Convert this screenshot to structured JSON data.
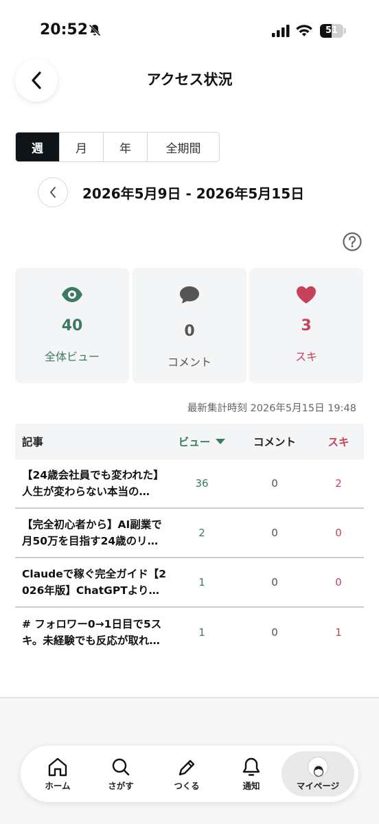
{
  "status_bar": {
    "time": "20:52",
    "battery": "51",
    "battery_level": 0.51
  },
  "header": {
    "title": "アクセス状況"
  },
  "period_tabs": [
    {
      "label": "週",
      "active": true
    },
    {
      "label": "月",
      "active": false
    },
    {
      "label": "年",
      "active": false
    },
    {
      "label": "全期間",
      "active": false
    }
  ],
  "date_range": "2026年5月9日 - 2026年5月15日",
  "stats": {
    "views": {
      "value": "40",
      "label": "全体ビュー",
      "color": "#3d7a66",
      "icon": "eye-icon"
    },
    "comments": {
      "value": "0",
      "label": "コメント",
      "color": "#555555",
      "icon": "speech-bubble-icon"
    },
    "likes": {
      "value": "3",
      "label": "スキ",
      "color": "#c8415a",
      "icon": "heart-icon"
    }
  },
  "updated_at": "最新集計時刻 2026年5月15日 19:48",
  "table": {
    "headers": {
      "title": "記事",
      "views": "ビュー",
      "comments": "コメント",
      "likes": "スキ"
    },
    "rows": [
      {
        "line1": "【24歳会社員でも変われた】",
        "line2": "人生が変わらない本当の…",
        "views": "36",
        "comments": "0",
        "likes": "2"
      },
      {
        "line1": "【完全初心者から】AI副業で",
        "line2": "月50万を目指す24歳のリ…",
        "views": "2",
        "comments": "0",
        "likes": "0"
      },
      {
        "line1": "Claudeで稼ぐ完全ガイド【2",
        "line2": "026年版】ChatGPTより…",
        "views": "1",
        "comments": "0",
        "likes": "0"
      },
      {
        "line1": "# フォロワー0→1日目で5ス",
        "line2": "キ。未経験でも反応が取れ…",
        "views": "1",
        "comments": "0",
        "likes": "1"
      }
    ]
  },
  "tab_bar": {
    "home": "ホーム",
    "search": "さがす",
    "create": "つくる",
    "notify": "通知",
    "mypage": "マイページ"
  },
  "colors": {
    "accent_green": "#3d7a66",
    "accent_red": "#c8415a",
    "dark": "#0f1419"
  }
}
